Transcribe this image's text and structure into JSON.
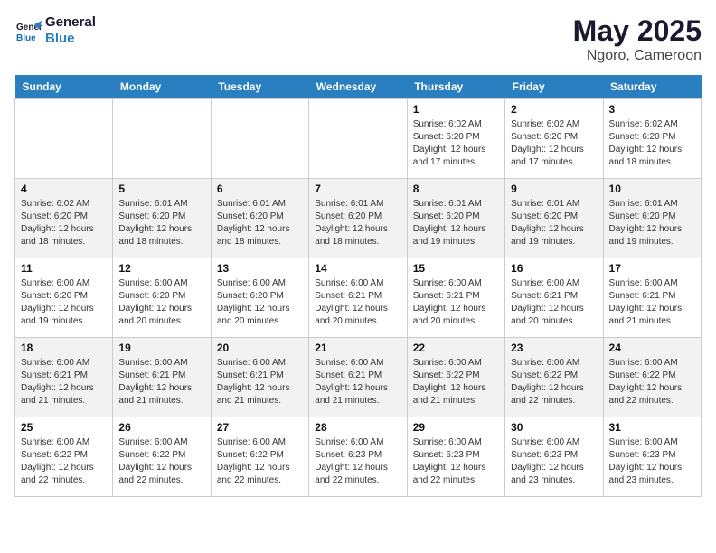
{
  "header": {
    "logo_line1": "General",
    "logo_line2": "Blue",
    "title": "May 2025",
    "subtitle": "Ngoro, Cameroon"
  },
  "days_of_week": [
    "Sunday",
    "Monday",
    "Tuesday",
    "Wednesday",
    "Thursday",
    "Friday",
    "Saturday"
  ],
  "weeks": [
    [
      {
        "day": "",
        "info": ""
      },
      {
        "day": "",
        "info": ""
      },
      {
        "day": "",
        "info": ""
      },
      {
        "day": "",
        "info": ""
      },
      {
        "day": "1",
        "info": "Sunrise: 6:02 AM\nSunset: 6:20 PM\nDaylight: 12 hours\nand 17 minutes."
      },
      {
        "day": "2",
        "info": "Sunrise: 6:02 AM\nSunset: 6:20 PM\nDaylight: 12 hours\nand 17 minutes."
      },
      {
        "day": "3",
        "info": "Sunrise: 6:02 AM\nSunset: 6:20 PM\nDaylight: 12 hours\nand 18 minutes."
      }
    ],
    [
      {
        "day": "4",
        "info": "Sunrise: 6:02 AM\nSunset: 6:20 PM\nDaylight: 12 hours\nand 18 minutes."
      },
      {
        "day": "5",
        "info": "Sunrise: 6:01 AM\nSunset: 6:20 PM\nDaylight: 12 hours\nand 18 minutes."
      },
      {
        "day": "6",
        "info": "Sunrise: 6:01 AM\nSunset: 6:20 PM\nDaylight: 12 hours\nand 18 minutes."
      },
      {
        "day": "7",
        "info": "Sunrise: 6:01 AM\nSunset: 6:20 PM\nDaylight: 12 hours\nand 18 minutes."
      },
      {
        "day": "8",
        "info": "Sunrise: 6:01 AM\nSunset: 6:20 PM\nDaylight: 12 hours\nand 19 minutes."
      },
      {
        "day": "9",
        "info": "Sunrise: 6:01 AM\nSunset: 6:20 PM\nDaylight: 12 hours\nand 19 minutes."
      },
      {
        "day": "10",
        "info": "Sunrise: 6:01 AM\nSunset: 6:20 PM\nDaylight: 12 hours\nand 19 minutes."
      }
    ],
    [
      {
        "day": "11",
        "info": "Sunrise: 6:00 AM\nSunset: 6:20 PM\nDaylight: 12 hours\nand 19 minutes."
      },
      {
        "day": "12",
        "info": "Sunrise: 6:00 AM\nSunset: 6:20 PM\nDaylight: 12 hours\nand 20 minutes."
      },
      {
        "day": "13",
        "info": "Sunrise: 6:00 AM\nSunset: 6:20 PM\nDaylight: 12 hours\nand 20 minutes."
      },
      {
        "day": "14",
        "info": "Sunrise: 6:00 AM\nSunset: 6:21 PM\nDaylight: 12 hours\nand 20 minutes."
      },
      {
        "day": "15",
        "info": "Sunrise: 6:00 AM\nSunset: 6:21 PM\nDaylight: 12 hours\nand 20 minutes."
      },
      {
        "day": "16",
        "info": "Sunrise: 6:00 AM\nSunset: 6:21 PM\nDaylight: 12 hours\nand 20 minutes."
      },
      {
        "day": "17",
        "info": "Sunrise: 6:00 AM\nSunset: 6:21 PM\nDaylight: 12 hours\nand 21 minutes."
      }
    ],
    [
      {
        "day": "18",
        "info": "Sunrise: 6:00 AM\nSunset: 6:21 PM\nDaylight: 12 hours\nand 21 minutes."
      },
      {
        "day": "19",
        "info": "Sunrise: 6:00 AM\nSunset: 6:21 PM\nDaylight: 12 hours\nand 21 minutes."
      },
      {
        "day": "20",
        "info": "Sunrise: 6:00 AM\nSunset: 6:21 PM\nDaylight: 12 hours\nand 21 minutes."
      },
      {
        "day": "21",
        "info": "Sunrise: 6:00 AM\nSunset: 6:21 PM\nDaylight: 12 hours\nand 21 minutes."
      },
      {
        "day": "22",
        "info": "Sunrise: 6:00 AM\nSunset: 6:22 PM\nDaylight: 12 hours\nand 21 minutes."
      },
      {
        "day": "23",
        "info": "Sunrise: 6:00 AM\nSunset: 6:22 PM\nDaylight: 12 hours\nand 22 minutes."
      },
      {
        "day": "24",
        "info": "Sunrise: 6:00 AM\nSunset: 6:22 PM\nDaylight: 12 hours\nand 22 minutes."
      }
    ],
    [
      {
        "day": "25",
        "info": "Sunrise: 6:00 AM\nSunset: 6:22 PM\nDaylight: 12 hours\nand 22 minutes."
      },
      {
        "day": "26",
        "info": "Sunrise: 6:00 AM\nSunset: 6:22 PM\nDaylight: 12 hours\nand 22 minutes."
      },
      {
        "day": "27",
        "info": "Sunrise: 6:00 AM\nSunset: 6:22 PM\nDaylight: 12 hours\nand 22 minutes."
      },
      {
        "day": "28",
        "info": "Sunrise: 6:00 AM\nSunset: 6:23 PM\nDaylight: 12 hours\nand 22 minutes."
      },
      {
        "day": "29",
        "info": "Sunrise: 6:00 AM\nSunset: 6:23 PM\nDaylight: 12 hours\nand 22 minutes."
      },
      {
        "day": "30",
        "info": "Sunrise: 6:00 AM\nSunset: 6:23 PM\nDaylight: 12 hours\nand 23 minutes."
      },
      {
        "day": "31",
        "info": "Sunrise: 6:00 AM\nSunset: 6:23 PM\nDaylight: 12 hours\nand 23 minutes."
      }
    ]
  ]
}
